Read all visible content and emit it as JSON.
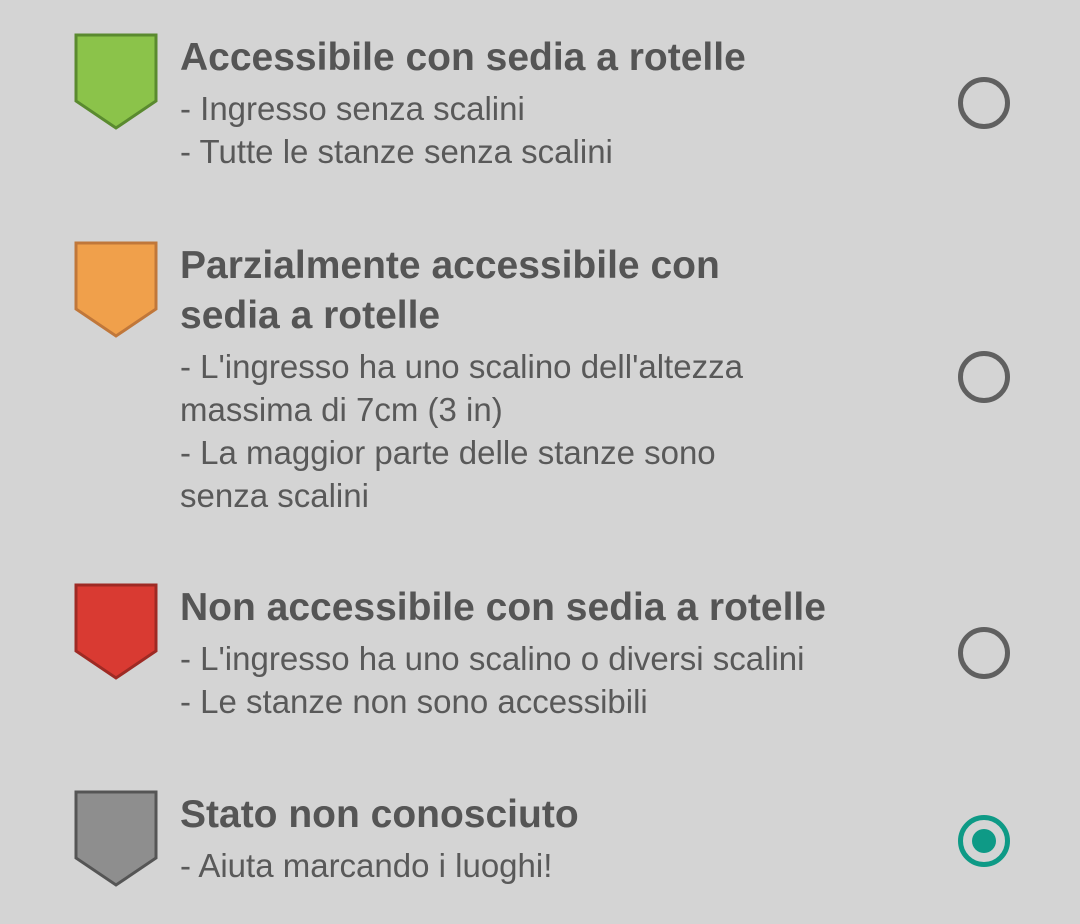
{
  "options": [
    {
      "title": "Accessibile con sedia a rotelle",
      "description": "- Ingresso senza scalini\n- Tutte le stanze senza scalini",
      "color": "#8bc34a",
      "border_color": "#5a8a2f",
      "icon": "green-shield-marker-icon",
      "selected": false
    },
    {
      "title": "Parzialmente accessibile con\nsedia a rotelle",
      "description": "- L'ingresso ha uno scalino dell'altezza\nmassima di 7cm (3 in)\n- La maggior parte delle stanze sono\nsenza scalini",
      "color": "#f0a04b",
      "border_color": "#c0773a",
      "icon": "orange-shield-marker-icon",
      "selected": false
    },
    {
      "title": "Non accessibile con sedia a rotelle",
      "description": "- L'ingresso ha uno scalino o diversi scalini\n- Le stanze non sono accessibili",
      "color": "#d93a32",
      "border_color": "#9e2a24",
      "icon": "red-shield-marker-icon",
      "selected": false
    },
    {
      "title": "Stato non conosciuto",
      "description": "- Aiuta marcando i luoghi!",
      "color": "#8e8e8e",
      "border_color": "#555555",
      "icon": "gray-shield-marker-icon",
      "selected": true
    }
  ],
  "accent_color": "#0e9a86"
}
